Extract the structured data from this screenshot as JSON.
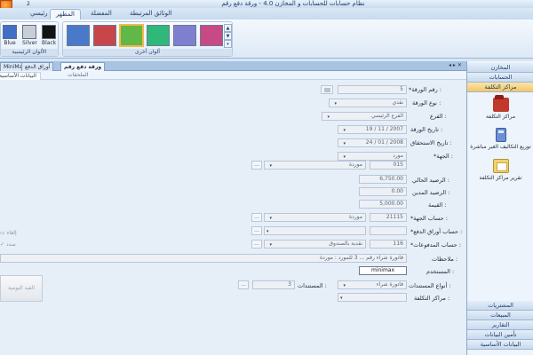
{
  "title_bar": {
    "title": "نظام حسابات للحسابات و المخازن 4.0 - ورقة دفع رقم",
    "qat_number": "2"
  },
  "ribbon": {
    "tabs": [
      {
        "label": "رئيسي",
        "active": false
      },
      {
        "label": "المظهر",
        "active": true
      },
      {
        "label": "المفضلة",
        "active": false
      },
      {
        "label": "الوثائق المرتبطة",
        "active": false
      }
    ],
    "main_colors": {
      "group_label": "الألوان الرئيسية",
      "swatches": [
        {
          "label": "Blue",
          "color": "#3f6fc6"
        },
        {
          "label": "Silver",
          "color": "#c9ced6"
        },
        {
          "label": "Black",
          "color": "#141414"
        }
      ]
    },
    "other_colors": {
      "group_label": "ألوان أخرى",
      "swatches": [
        {
          "name": "blue-swatch",
          "color": "#4a79c9"
        },
        {
          "name": "red-swatch",
          "color": "#c8454a"
        },
        {
          "name": "green-swatch",
          "color": "#62b846",
          "selected": true
        },
        {
          "name": "teal-swatch",
          "color": "#2fb87a"
        },
        {
          "name": "purple-swatch",
          "color": "#7f7fd0"
        },
        {
          "name": "pink-swatch",
          "color": "#c74a86"
        }
      ]
    }
  },
  "doc_tabs": {
    "tabs": [
      {
        "label": "MiniMax",
        "active": false
      },
      {
        "label": "ورقة دفع رقم",
        "active": true
      },
      {
        "label": "أوراق الدفع",
        "active": false
      }
    ],
    "controls": "◂ ▸ ✕"
  },
  "sub_tabs": [
    {
      "label": "البيانات الأساسية",
      "active": true
    },
    {
      "label": "الملحقات",
      "active": false
    }
  ],
  "form": {
    "paper_number": {
      "label": "*رقم الورقة :",
      "value": "5"
    },
    "paper_type": {
      "label": "نوع الورقة :",
      "value": "نقدي"
    },
    "branch": {
      "label": "الفرع :",
      "value": "الفرع الرئيسي"
    },
    "paper_date": {
      "label": "تاريخ الورقة :",
      "value": "19 / 11 / 2007"
    },
    "due_date": {
      "label": "تاريخ الاستحقاق :",
      "value": "24 / 01 / 2008"
    },
    "party": {
      "label": "*الجهة :",
      "value": "مورد"
    },
    "party_code": {
      "value": "015",
      "name": "موردة"
    },
    "current_balance": {
      "label": "الرصيد الحالي :",
      "value": "6,750.00"
    },
    "previous_balance": {
      "label": "الرصيد المدين :",
      "value": "0.00"
    },
    "amount": {
      "label": "القيمة :",
      "value": "5,000.00"
    },
    "party_account": {
      "label": "*حساب الجهة :",
      "code": "21115",
      "name": "موردة"
    },
    "payment_papers_account": {
      "label": "*حساب أوراق الدفع :"
    },
    "payments_account": {
      "label": "*حساب المدفوعات :",
      "code": "116",
      "name": "نقدية بالصندوق"
    },
    "notes": {
      "label": "ملاحظات :",
      "value": "فاتورة شراء رقم ... 3 للمورد : موردة"
    },
    "user": {
      "label": "المستخدم :",
      "value": "minimax"
    },
    "document_types": {
      "label": "أنواع المستندات :",
      "value": "فاتورة شراء",
      "count_label": "المستندات :",
      "count": "3"
    },
    "cost_centers": {
      "label": "مراكز التكلفة :"
    },
    "side_cancel": "إلغاء",
    "side_paid": "سدد",
    "journal_button": "القيد اليومية"
  },
  "nav": {
    "top_headers": [
      {
        "label": "المخازن",
        "active": false
      },
      {
        "label": "الحسابات",
        "active": false
      },
      {
        "label": "مراكز التكلفة",
        "active": true
      }
    ],
    "items": [
      {
        "label": "مراكز التكلفة",
        "icon": "folder-icon"
      },
      {
        "label": "توزيع التكاليف الغير مباشرة",
        "icon": "calculator-icon"
      },
      {
        "label": "تقرير مراكز التكلفة",
        "icon": "report-icon"
      }
    ],
    "bottom_headers": [
      {
        "label": "المشتريات"
      },
      {
        "label": "المبيعات"
      },
      {
        "label": "التقارير"
      },
      {
        "label": "تأمين البيانات"
      },
      {
        "label": "البيانات الأساسية"
      }
    ]
  }
}
